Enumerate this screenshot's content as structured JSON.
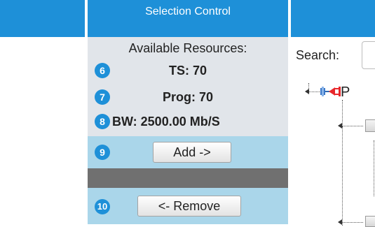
{
  "selection_control": {
    "title": "Selection Control",
    "available_resources_label": "Available Resources:",
    "resources": [
      {
        "badge": "6",
        "text": "TS: 70"
      },
      {
        "badge": "7",
        "text": "Prog: 70"
      },
      {
        "badge": "8",
        "text": "BW: 2500.00 Mb/S"
      }
    ],
    "add": {
      "badge": "9",
      "label": "Add ->"
    },
    "remove": {
      "badge": "10",
      "label": "<- Remove"
    }
  },
  "tree_panel": {
    "search_label": "Search:",
    "root_node_label_partial": "P"
  },
  "colors": {
    "header_blue": "#1e90d8",
    "panel_gray": "#e1e5ea",
    "action_blue": "#aad6ea",
    "separator_gray": "#707070",
    "connector_red": "#e8272b"
  }
}
